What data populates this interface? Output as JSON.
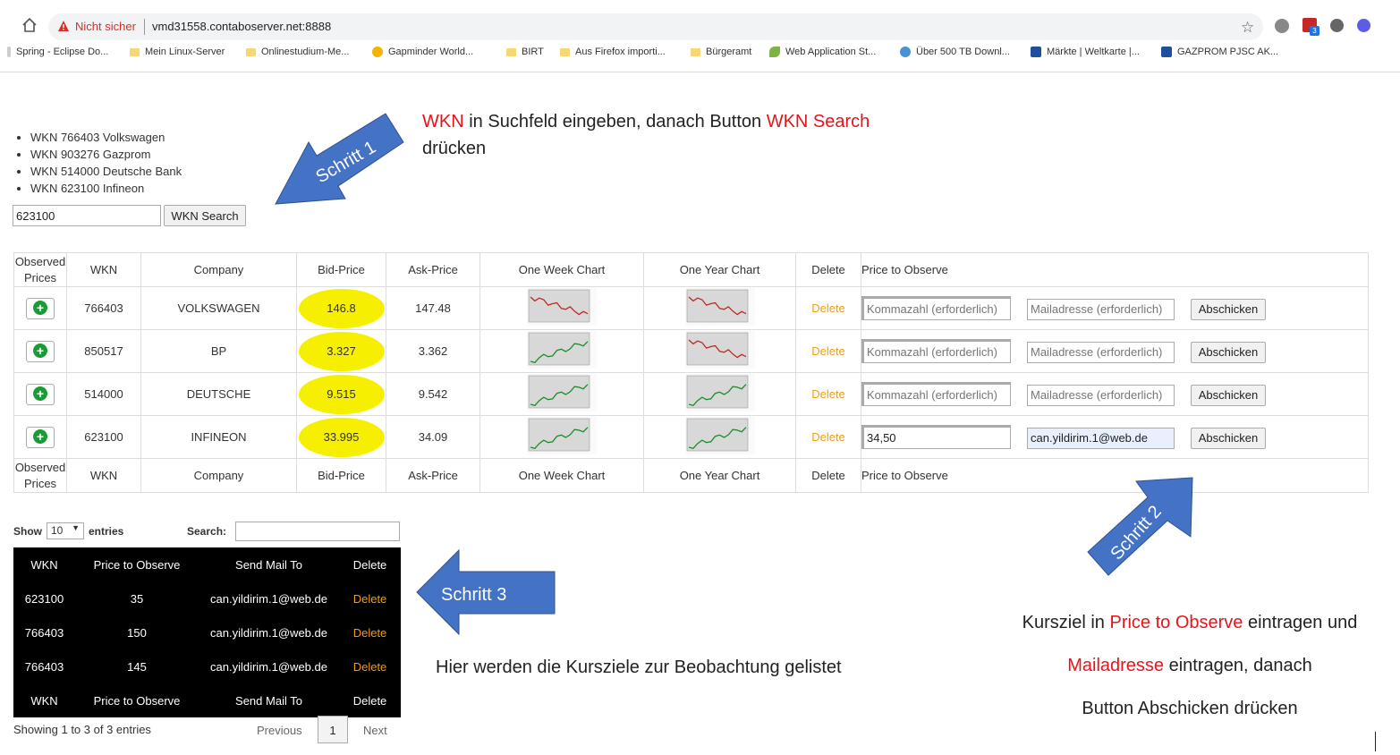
{
  "browser": {
    "security_label": "Nicht sicher",
    "url": "vmd31558.contaboserver.net:8888",
    "extension_badge": "3",
    "bookmarks": [
      "Spring - Eclipse Do...",
      "Mein Linux-Server",
      "Onlinestudium-Me...",
      "Gapminder World...",
      "BIRT",
      "Aus Firefox importi...",
      "Bürgeramt",
      "Web Application St...",
      "Über 500 TB Downl...",
      "Märkte | Weltkarte |...",
      "GAZPROM PJSC AK..."
    ]
  },
  "wkn_list": [
    "WKN 766403 Volkswagen",
    "WKN 903276 Gazprom",
    "WKN 514000 Deutsche Bank",
    "WKN 623100 Infineon"
  ],
  "search": {
    "value": "623100",
    "button": "WKN Search"
  },
  "table": {
    "headers": [
      "Observed Prices",
      "WKN",
      "Company",
      "Bid-Price",
      "Ask-Price",
      "One Week Chart",
      "One Year Chart",
      "Delete",
      "Price to Observe"
    ],
    "rows": [
      {
        "wkn": "766403",
        "company": "VOLKSWAGEN",
        "bid": "146.8",
        "ask": "147.48",
        "delete": "Delete",
        "price_value": "",
        "mail_value": "",
        "week_trend": "down",
        "year_trend": "down"
      },
      {
        "wkn": "850517",
        "company": "BP",
        "bid": "3.327",
        "ask": "3.362",
        "delete": "Delete",
        "price_value": "",
        "mail_value": "",
        "week_trend": "up",
        "year_trend": "down"
      },
      {
        "wkn": "514000",
        "company": "DEUTSCHE",
        "bid": "9.515",
        "ask": "9.542",
        "delete": "Delete",
        "price_value": "",
        "mail_value": "",
        "week_trend": "up",
        "year_trend": "up"
      },
      {
        "wkn": "623100",
        "company": "INFINEON",
        "bid": "33.995",
        "ask": "34.09",
        "delete": "Delete",
        "price_value": "34,50",
        "mail_value": "can.yildirim.1@web.de",
        "week_trend": "up",
        "year_trend": "up"
      }
    ],
    "price_placeholder": "Kommazahl (erforderlich)",
    "mail_placeholder": "Mailadresse (erforderlich)",
    "submit_label": "Abschicken"
  },
  "datatable": {
    "show_label": "Show",
    "entries_value": "10",
    "entries_label": "entries",
    "search_label": "Search:",
    "headers": [
      "WKN",
      "Price to Observe",
      "Send Mail To",
      "Delete"
    ],
    "rows": [
      {
        "wkn": "623100",
        "price": "35",
        "mail": "can.yildirim.1@web.de",
        "delete": "Delete"
      },
      {
        "wkn": "766403",
        "price": "150",
        "mail": "can.yildirim.1@web.de",
        "delete": "Delete"
      },
      {
        "wkn": "766403",
        "price": "145",
        "mail": "can.yildirim.1@web.de",
        "delete": "Delete"
      }
    ],
    "info": "Showing 1 to 3 of 3 entries",
    "prev": "Previous",
    "page": "1",
    "next": "Next"
  },
  "annotations": {
    "schritt1": "Schritt 1",
    "schritt2": "Schritt 2",
    "schritt3": "Schritt 3",
    "note1_a": "WKN",
    "note1_b": " in Suchfeld eingeben, danach Button ",
    "note1_c": "WKN Search",
    "note1_d": "drücken",
    "note3": "Hier werden die Kursziele zur Beobachtung gelistet",
    "note2_l1a": "Kursziel in ",
    "note2_l1b": "Price to Observe",
    "note2_l1c": " eintragen und",
    "note2_l2a": "Mailadresse",
    "note2_l2b": " eintragen, danach",
    "note2_l3": "Button Abschicken drücken"
  },
  "colors": {
    "accent_red": "#e6141b",
    "arrow_blue": "#4472c4",
    "bid_yellow": "#f7ef00",
    "delete_orange": "#f39c12"
  }
}
